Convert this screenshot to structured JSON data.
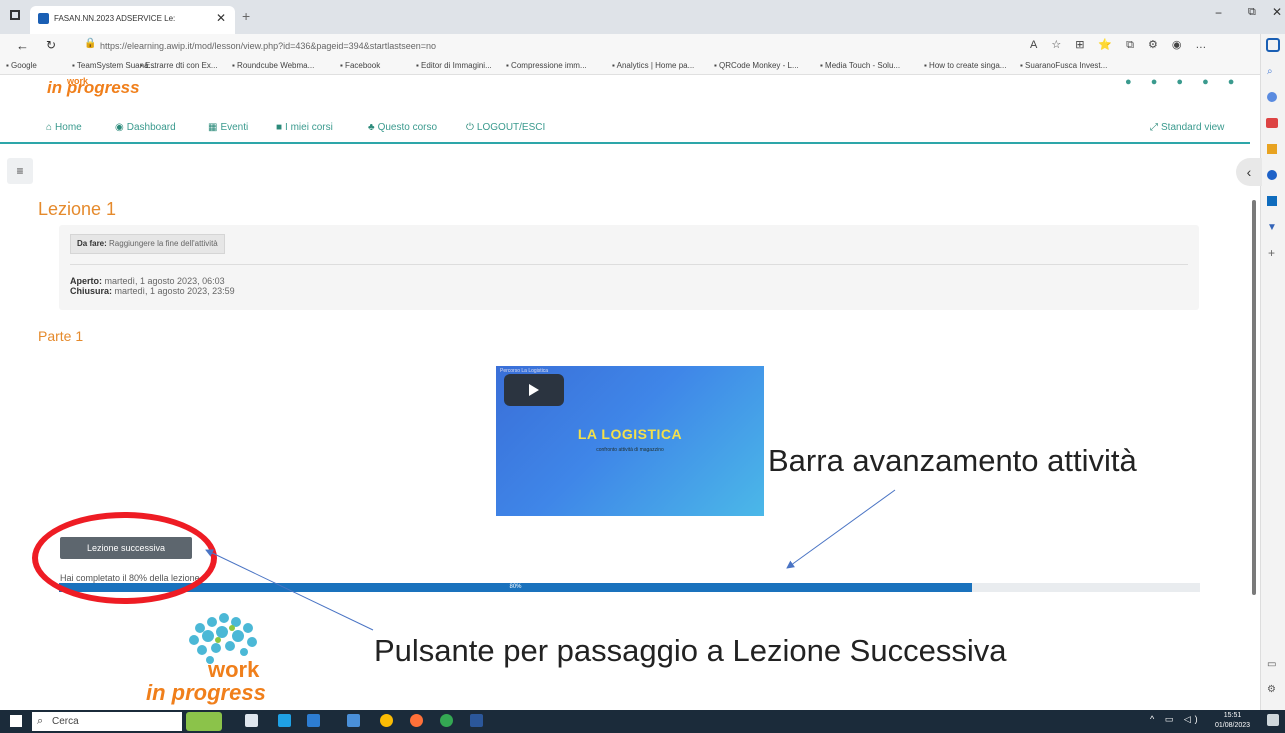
{
  "browser": {
    "tab_title": "FASAN.NN.2023 ADSERVICE Le: ",
    "url": "https://elearning.awip.it/mod/lesson/view.php?id=436&pageid=394&startlastseen=no",
    "bookmarks": [
      "Google",
      "TeamSystem Suana...",
      "Estrarre dti con Ex...",
      "Roundcube Webma...",
      "Facebook",
      "Editor di Immagini...",
      "Compressione imm...",
      "Analytics | Home pa...",
      "QRCode Monkey - L...",
      "Media Touch - Solu...",
      "How to create singa...",
      "SuaranoFusca Invest..."
    ]
  },
  "site": {
    "brand_top": "in progress",
    "nav": [
      "Home",
      "Dashboard",
      "Eventi",
      "I miei corsi",
      "Questo corso",
      "LOGOUT/ESCI"
    ],
    "standard_view": "Standard view"
  },
  "lesson": {
    "title": "Lezione 1",
    "todo_label": "Da fare:",
    "todo_text": "Raggiungere la fine dell'attività",
    "opened_label": "Aperto:",
    "opened_value": "martedì, 1 agosto 2023, 06:03",
    "closing_label": "Chiusura:",
    "closing_value": "martedì, 1 agosto 2023, 23:59",
    "part_title": "Parte 1",
    "video": {
      "caption": "Percorso La Logistica",
      "title": "LA LOGISTICA",
      "subtitle": "confronto attività di magazzino"
    },
    "next_button": "Lezione successiva",
    "progress_text": "Hai completato il 80% della lezione.",
    "progress_label": "80%",
    "progress_value": 0.8
  },
  "annotations": {
    "progress": "Barra avanzamento attività",
    "next": "Pulsante per passaggio a Lezione Successiva"
  },
  "footer_brand": {
    "line1": "work",
    "line2": "in progress"
  },
  "taskbar": {
    "search": "Cerca",
    "time": "15:51",
    "date": "01/08/2023"
  },
  "colors": {
    "brand_orange": "#f07f1b",
    "teal": "#2da6a9",
    "progress_blue": "#1a72bd",
    "highlight_red": "#ee1c24"
  }
}
